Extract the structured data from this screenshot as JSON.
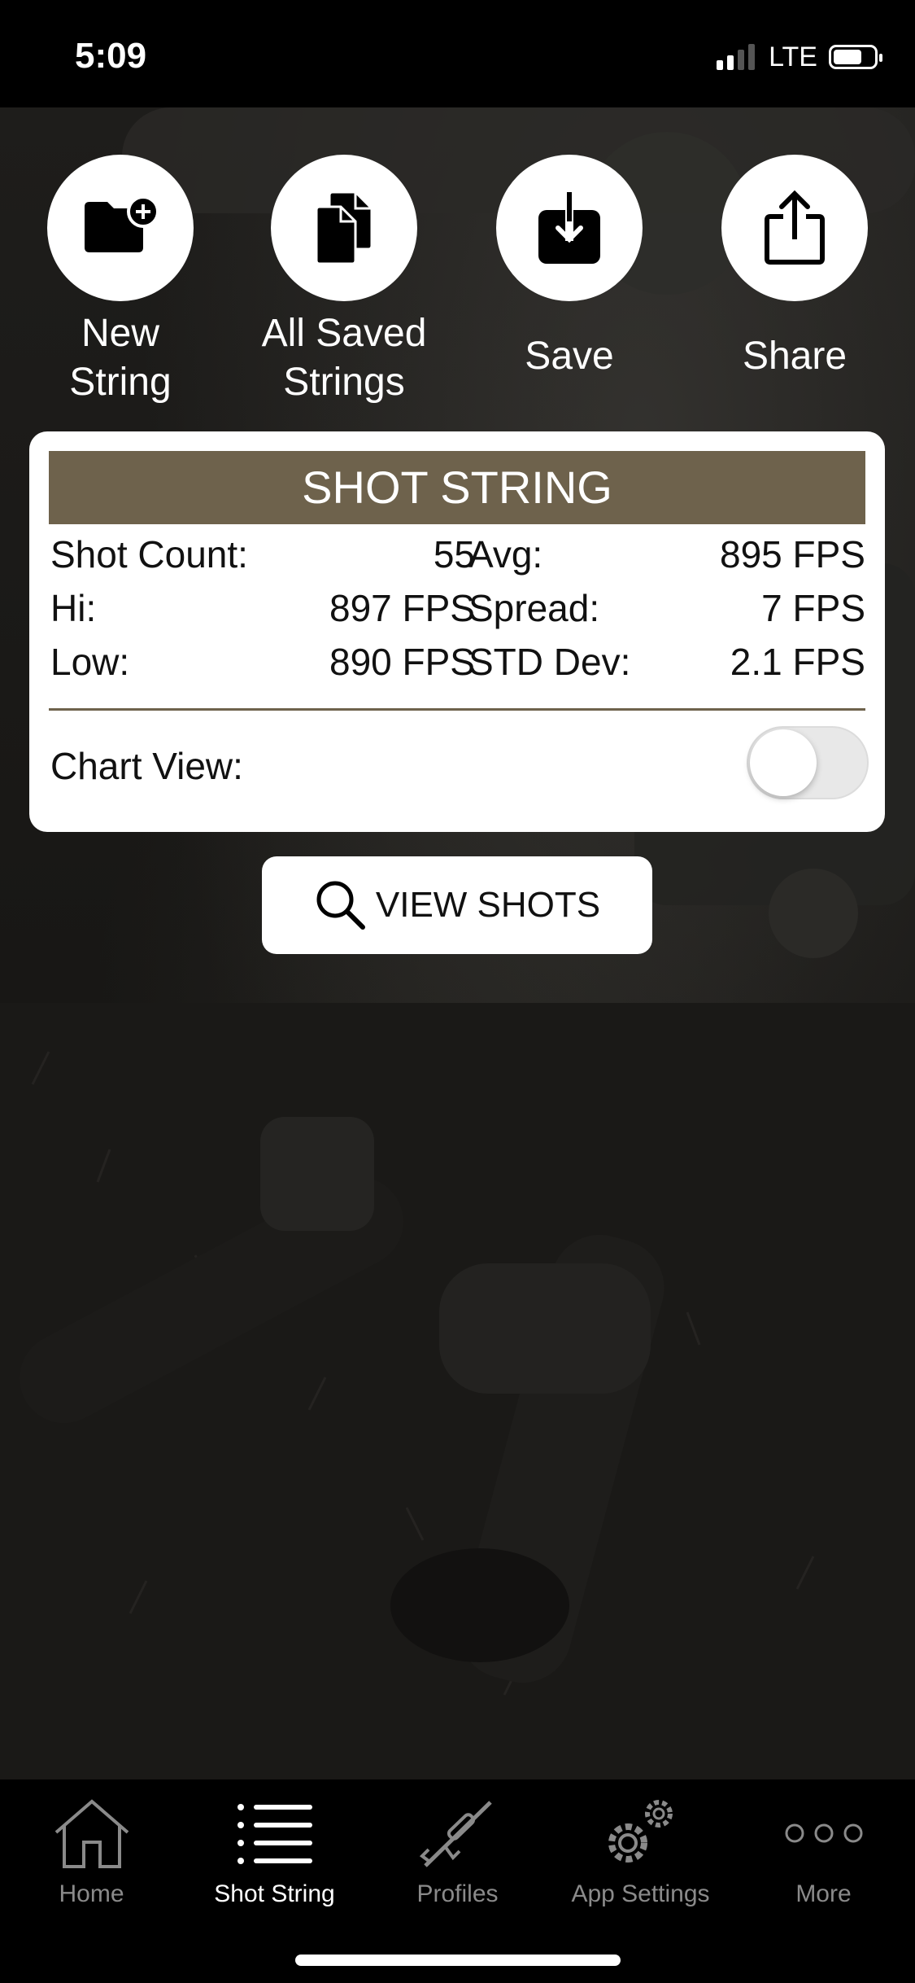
{
  "status_bar": {
    "time": "5:09",
    "network": "LTE"
  },
  "actions": [
    {
      "label_line1": "New",
      "label_line2": "String",
      "icon": "folder-add-icon"
    },
    {
      "label_line1": "All Saved",
      "label_line2": "Strings",
      "icon": "copy-documents-icon"
    },
    {
      "label": "Save",
      "icon": "download-icon"
    },
    {
      "label": "Share",
      "icon": "share-icon"
    }
  ],
  "card": {
    "title": "SHOT STRING",
    "stats": {
      "shot_count_label": "Shot Count:",
      "shot_count": "55",
      "hi_label": "Hi:",
      "hi": "897 FPS",
      "low_label": "Low:",
      "low": "890 FPS",
      "avg_label": "Avg:",
      "avg": "895 FPS",
      "spread_label": "Spread:",
      "spread": "7 FPS",
      "std_label": "STD Dev:",
      "std": "2.1 FPS"
    },
    "chart_view_label": "Chart View:",
    "chart_view_on": false
  },
  "view_shots_label": "VIEW SHOTS",
  "tabs": [
    {
      "label": "Home",
      "icon": "home-icon",
      "active": false
    },
    {
      "label": "Shot String",
      "icon": "list-icon",
      "active": true
    },
    {
      "label": "Profiles",
      "icon": "rifle-icon",
      "active": false
    },
    {
      "label": "App Settings",
      "icon": "gears-icon",
      "active": false
    },
    {
      "label": "More",
      "icon": "more-dots-icon",
      "active": false
    }
  ],
  "colors": {
    "accent": "#6e624c",
    "tab_inactive": "#8a8a8a",
    "tab_active": "#ffffff"
  }
}
